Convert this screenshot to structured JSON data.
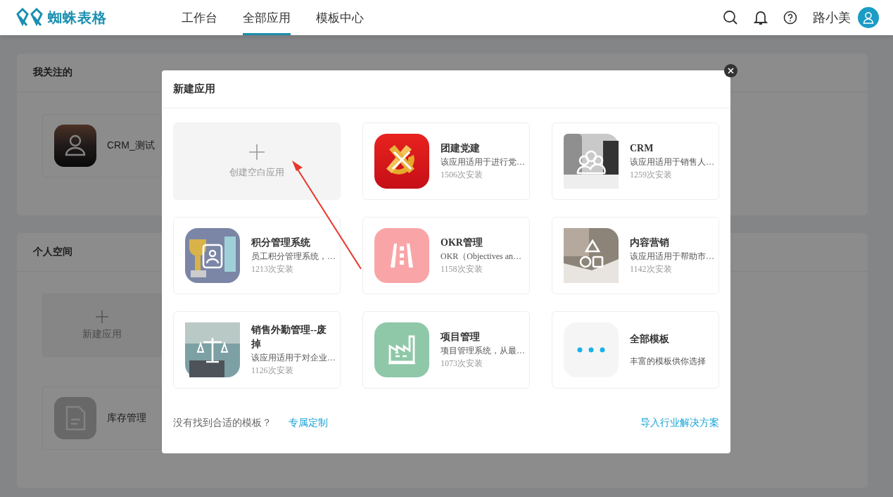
{
  "header": {
    "logo_text": "蜘蛛表格",
    "nav": [
      {
        "label": "工作台",
        "selected": false
      },
      {
        "label": "全部应用",
        "selected": true
      },
      {
        "label": "模板中心",
        "selected": false
      }
    ],
    "user_name": "路小美"
  },
  "sections": [
    {
      "title": "我关注的",
      "apps": [
        {
          "kind": "app",
          "name": "CRM_测试"
        }
      ]
    },
    {
      "title": "个人空间",
      "apps": [
        {
          "kind": "new",
          "label": "新建应用"
        },
        {
          "kind": "app",
          "name": "库存管理"
        }
      ]
    }
  ],
  "dialog": {
    "title": "新建应用",
    "blank_label": "创建空白应用",
    "templates": [
      {
        "kind": "template",
        "name": "团建党建",
        "description": "该应用适用于进行党…",
        "installs": "1506次安装"
      },
      {
        "kind": "template",
        "name": "CRM",
        "description": "该应用适用于销售人…",
        "installs": "1259次安装"
      },
      {
        "kind": "template",
        "name": "积分管理系统",
        "description": "员工积分管理系统，…",
        "installs": "1213次安装"
      },
      {
        "kind": "template",
        "name": "OKR管理",
        "description": "OKR（Objectives an…",
        "installs": "1158次安装"
      },
      {
        "kind": "template",
        "name": "内容营销",
        "description": "该应用适用于帮助市…",
        "installs": "1142次安装"
      },
      {
        "kind": "template",
        "name": "销售外勤管理--废掉",
        "description": "该应用适用于对企业…",
        "installs": "1126次安装"
      },
      {
        "kind": "template",
        "name": "项目管理",
        "description": "项目管理系统，从最…",
        "installs": "1073次安装"
      },
      {
        "kind": "more",
        "name": "全部模板",
        "description": "丰富的模板供你选择"
      }
    ],
    "footer_hint": "没有找到合适的模板？",
    "custom_link": "专属定制",
    "import_link": "导入行业解决方案"
  }
}
